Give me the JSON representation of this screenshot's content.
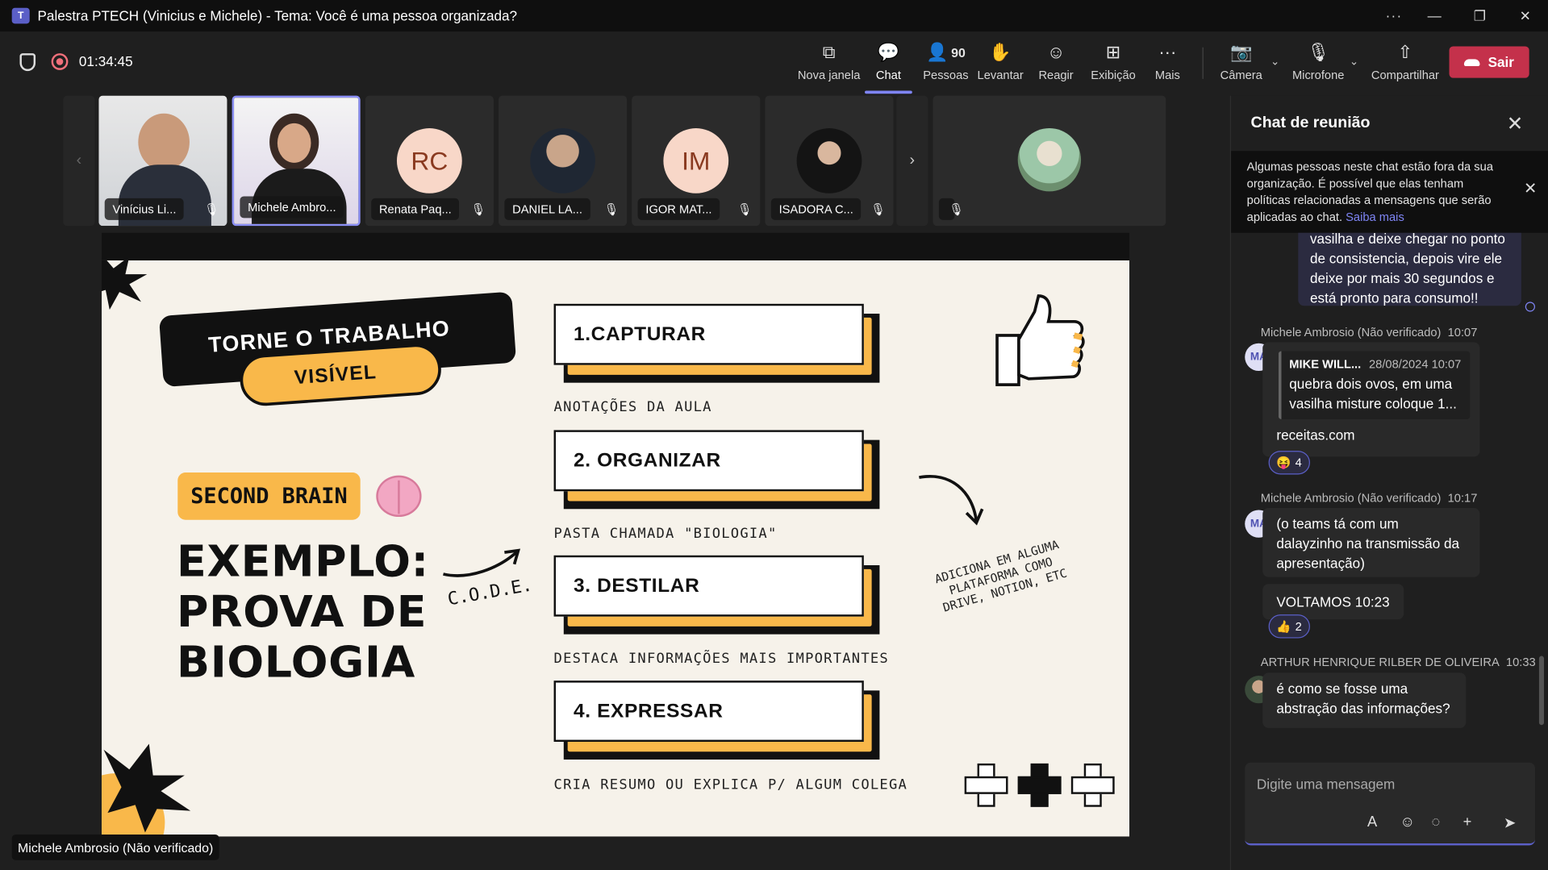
{
  "window": {
    "title": "Palestra PTECH (Vinicius e Michele) - Tema: Você é uma pessoa organizada?",
    "controls": {
      "more": "···",
      "minimize": "—",
      "restore": "❐",
      "close": "✕"
    }
  },
  "meeting": {
    "timer": "01:34:45",
    "toolbar": {
      "new_window": "Nova janela",
      "chat": "Chat",
      "people": "Pessoas",
      "people_count": "90",
      "raise": "Levantar",
      "react": "Reagir",
      "view": "Exibição",
      "more": "Mais",
      "camera": "Câmera",
      "mic": "Microfone",
      "share": "Compartilhar",
      "leave": "Sair"
    },
    "icons": {
      "new_window": "⧉",
      "chat": "💬",
      "people": "👤",
      "raise": "✋",
      "react": "☺",
      "view": "⊞",
      "more": "···",
      "camera": "📷",
      "mic": "🎙",
      "share": "⇧",
      "chevron": "⌄"
    }
  },
  "participants": [
    {
      "name": "Vinícius Li...",
      "initials": "",
      "muted": true
    },
    {
      "name": "Michele Ambro...",
      "initials": "",
      "muted": false
    },
    {
      "name": "Renata Paq...",
      "initials": "RC",
      "muted": true
    },
    {
      "name": "DANIEL LA...",
      "initials": "",
      "muted": true
    },
    {
      "name": "IGOR MAT...",
      "initials": "IM",
      "muted": true
    },
    {
      "name": "ISADORA C...",
      "initials": "",
      "muted": true
    },
    {
      "name": "",
      "initials": "",
      "muted": true
    }
  ],
  "slide": {
    "header_line1": "TORNE O TRABALHO",
    "header_line2": "VISÍVEL",
    "badge": "SECOND BRAIN",
    "example_l1": "EXEMPLO:",
    "example_l2": "PROVA DE",
    "example_l3": "BIOLOGIA",
    "code_label": "C.O.D.E.",
    "steps": [
      {
        "title": "1.CAPTURAR",
        "caption": "ANOTAÇÕES DA AULA"
      },
      {
        "title": "2. ORGANIZAR",
        "caption": "PASTA CHAMADA \"BIOLOGIA\""
      },
      {
        "title": "3. DESTILAR",
        "caption": "DESTACA INFORMAÇÕES MAIS IMPORTANTES"
      },
      {
        "title": "4. EXPRESSAR",
        "caption": "CRIA RESUMO OU EXPLICA P/ ALGUM COLEGA"
      }
    ],
    "side_note": "ADICIONA EM ALGUMA PLATAFORMA COMO DRIVE, NOTION, ETC"
  },
  "presenter_label": "Michele Ambrosio (Não verificado)",
  "chat": {
    "title": "Chat de reunião",
    "notice_text": "Algumas pessoas neste chat estão fora da sua organização. É possível que elas tenham políticas relacionadas a mensagens que serão aplicadas ao chat.",
    "notice_link": "Saiba mais",
    "my_message": "vasilha e deixe chegar no ponto de consistencia, depois vire ele deixe por mais 30 segundos e está pronto para consumo!!",
    "messages": [
      {
        "sender": "Michele Ambrosio (Não verificado)",
        "time": "10:07",
        "initials": "MA",
        "quote_author": "MIKE WILL...",
        "quote_time": "28/08/2024 10:07",
        "quote_text": "quebra dois ovos, em uma vasilha misture coloque 1...",
        "text": "receitas.com",
        "reaction_emoji": "😝",
        "reaction_count": "4"
      },
      {
        "sender": "Michele Ambrosio (Não verificado)",
        "time": "10:17",
        "initials": "MA",
        "text": "(o teams tá com um dalayzinho na transmissão da apresentação)",
        "text2": "VOLTAMOS 10:23",
        "reaction_emoji": "👍",
        "reaction_count": "2"
      },
      {
        "sender": "ARTHUR HENRIQUE RILBER DE OLIVEIRA",
        "time": "10:33",
        "text": "é como se fosse uma abstração das informações?"
      }
    ],
    "composer_placeholder": "Digite uma mensagem",
    "composer_icons": {
      "format": "A",
      "emoji": "☺",
      "loop": "◌",
      "attach": "+",
      "send": "➤"
    }
  }
}
